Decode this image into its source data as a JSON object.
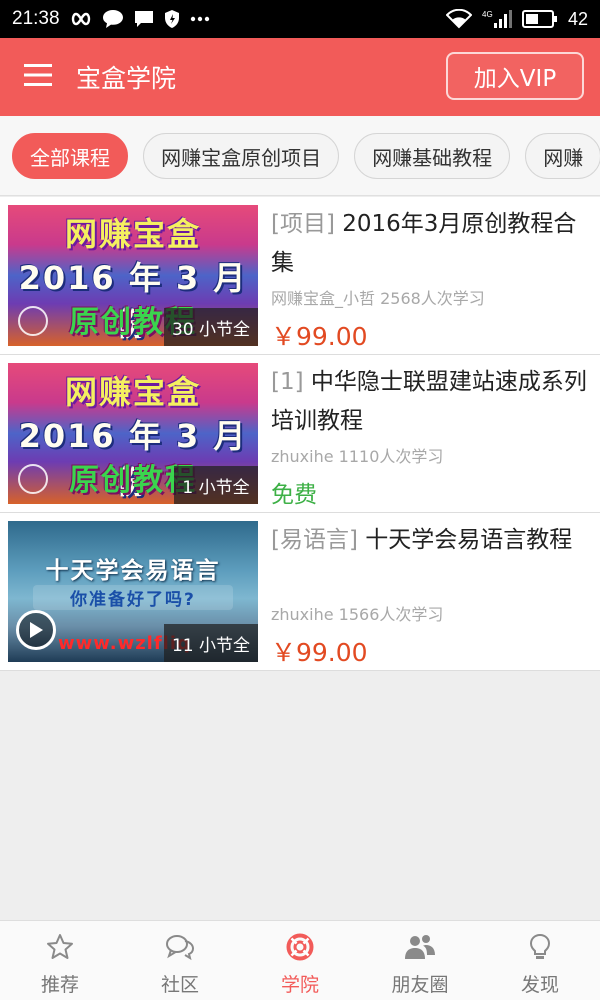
{
  "status_bar": {
    "time": "21:38",
    "battery": "42",
    "signal_tag": "4G"
  },
  "header": {
    "title": "宝盒学院",
    "vip_button": "加入VIP",
    "menu_icon": "hamburger-icon"
  },
  "categories": [
    {
      "label": "全部课程",
      "active": true
    },
    {
      "label": "网赚宝盒原创项目",
      "active": false
    },
    {
      "label": "网赚基础教程",
      "active": false
    },
    {
      "label": "网赚",
      "active": false
    }
  ],
  "courses": [
    {
      "tag": "[项目]",
      "title": "2016年3月原创教程合集",
      "meta": "网赚宝盒_小哲 2568人次学习",
      "price": "￥99.00",
      "sections": "30 小节全",
      "thumb_lines": [
        "网赚宝盒",
        "2016 年 3 月份",
        "原创教程"
      ]
    },
    {
      "tag": "[1]",
      "title": "中华隐士联盟建站速成系列培训教程",
      "meta": "zhuxihe 1110人次学习",
      "price": "免费",
      "sections": "1 小节全",
      "thumb_lines": [
        "网赚宝盒",
        "2016 年 3 月份",
        "原创教程"
      ]
    },
    {
      "tag": "[易语言]",
      "title": "十天学会易语言教程",
      "meta": "zhuxihe 1566人次学习",
      "price": "￥99.00",
      "sections": "11 小节全",
      "thumb_lines": [
        "十天学会易语言",
        "你准备好了吗?",
        "www.wzlfliq"
      ]
    }
  ],
  "bottom_nav": [
    {
      "label": "推荐",
      "icon": "star-icon",
      "active": false
    },
    {
      "label": "社区",
      "icon": "chat-bubbles-icon",
      "active": false
    },
    {
      "label": "学院",
      "icon": "lifebuoy-icon",
      "active": true
    },
    {
      "label": "朋友圈",
      "icon": "people-icon",
      "active": false
    },
    {
      "label": "发现",
      "icon": "lightbulb-icon",
      "active": false
    }
  ],
  "colors": {
    "brand": "#f25b59",
    "price": "#e24a22",
    "free": "#3db046"
  }
}
